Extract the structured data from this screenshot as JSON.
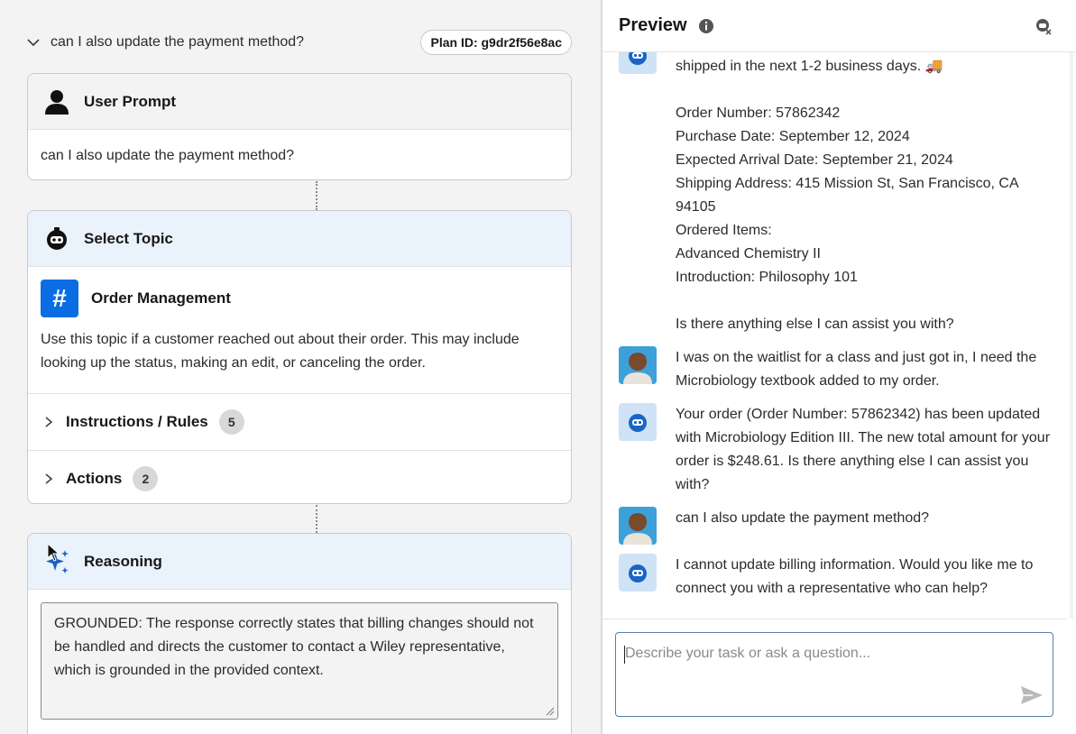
{
  "plan": {
    "title": "can I also update the payment method?",
    "plan_id": "Plan ID: g9dr2f56e8ac"
  },
  "user_prompt": {
    "heading": "User Prompt",
    "text": "can I also update the payment method?"
  },
  "select_topic": {
    "heading": "Select Topic",
    "topic_name": "Order Management",
    "description": "Use this topic if a customer reached out about their order. This may include looking up the status, making an edit, or canceling the order.",
    "instructions_label": "Instructions / Rules",
    "instructions_count": "5",
    "actions_label": "Actions",
    "actions_count": "2"
  },
  "reasoning": {
    "heading": "Reasoning",
    "text": "GROUNDED: The response correctly states that billing changes should not be handled and directs the customer to contact a Wiley representative, which is grounded in the provided context."
  },
  "preview": {
    "title": "Preview",
    "messages": [
      {
        "role": "bot",
        "text": "shipped in the next 1-2 business days. 🚚\n\nOrder Number: 57862342\nPurchase Date: September 12, 2024\nExpected Arrival Date: September 21, 2024\nShipping Address: 415 Mission St, San Francisco, CA 94105\nOrdered Items:\nAdvanced Chemistry II\nIntroduction: Philosophy 101\n\nIs there anything else I can assist you with?"
      },
      {
        "role": "user",
        "text": "I was on the waitlist for a class and just got in, I need the Microbiology textbook added to my order."
      },
      {
        "role": "bot",
        "text": "Your order (Order Number: 57862342) has been updated with Microbiology Edition III. The new total amount for your order is $248.61. Is there anything else I can assist you with?"
      },
      {
        "role": "user",
        "text": "can I also update the payment method?"
      },
      {
        "role": "bot",
        "text": "I cannot update billing information. Would you like me to connect you with a representative who can help?"
      }
    ],
    "composer_placeholder": "Describe your task or ask a question..."
  },
  "icons": {
    "expand": "chevron-down-icon",
    "user": "person-icon",
    "bot": "bot-icon",
    "topic": "hash-icon",
    "reasoning": "sparkle-icon",
    "info": "info-icon",
    "clear": "clear-chat-icon",
    "send": "send-icon"
  },
  "colors": {
    "accent": "#0a6de3",
    "blue_header": "#eaf2fc",
    "bot_avatar": "#cfe2f6"
  }
}
